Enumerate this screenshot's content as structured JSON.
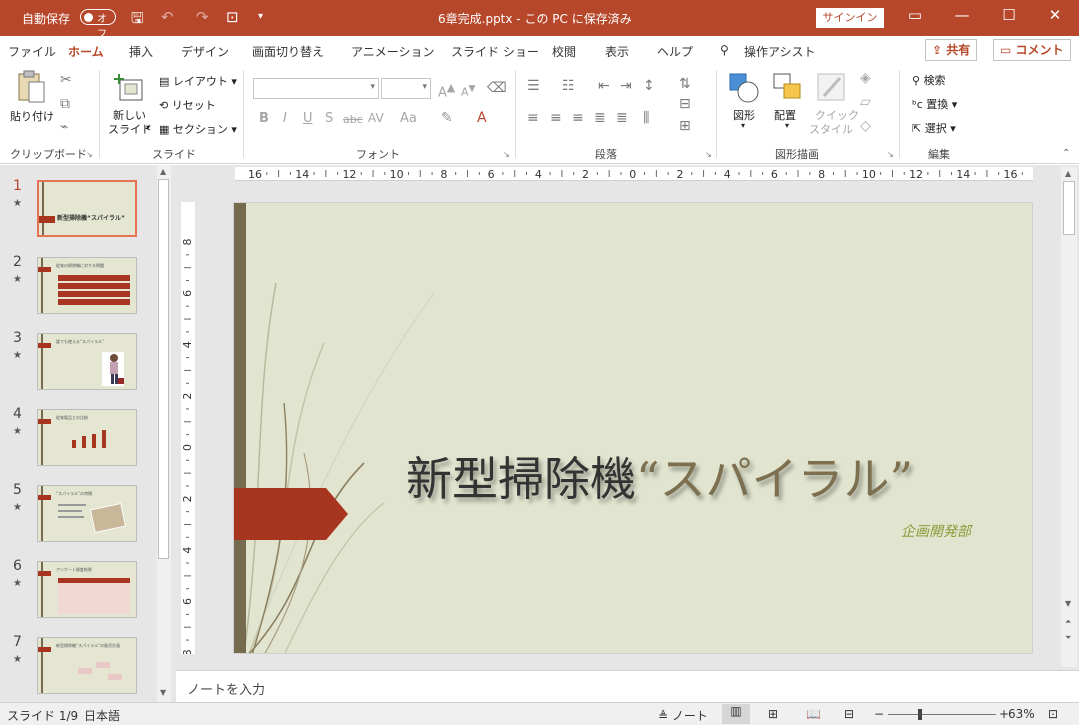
{
  "titlebar": {
    "autosave_label": "自動保存",
    "autosave_state": "オフ",
    "document_title": "6章完成.pptx  -  この PC に保存済み",
    "signin_label": "サインイン"
  },
  "tabs": [
    "ファイル",
    "ホーム",
    "挿入",
    "デザイン",
    "画面切り替え",
    "アニメーション",
    "スライド ショー",
    "校閲",
    "表示",
    "ヘルプ"
  ],
  "active_tab": "ホーム",
  "tell_me": "操作アシスト",
  "share_label": "共有",
  "comment_label": "コメント",
  "ribbon": {
    "clipboard": {
      "paste": "貼り付け",
      "group": "クリップボード"
    },
    "slides": {
      "new_slide_line1": "新しい",
      "new_slide_line2": "スライド",
      "layout": "レイアウト",
      "reset": "リセット",
      "section": "セクション",
      "group": "スライド"
    },
    "font": {
      "group": "フォント",
      "bold": "B",
      "italic": "I",
      "underline": "U",
      "shadow": "S",
      "strike": "abc",
      "spacing": "AV",
      "case": "Aa",
      "grow": "A",
      "shrink": "A"
    },
    "paragraph": {
      "group": "段落"
    },
    "drawing": {
      "shapes": "図形",
      "arrange": "配置",
      "quick_style_line1": "クイック",
      "quick_style_line2": "スタイル",
      "group": "図形描画"
    },
    "editing": {
      "find": "検索",
      "replace": "置換",
      "select": "選択",
      "group": "編集"
    }
  },
  "slides": [
    {
      "number": "1",
      "title": "新型掃除機“スパイラル”"
    },
    {
      "number": "2",
      "title": "従来の掃除機に対する問題"
    },
    {
      "number": "3",
      "title": "誰でも使える“スパイラル”"
    },
    {
      "number": "4",
      "title": "従来製品との比較"
    },
    {
      "number": "5",
      "title": "“スパイラル”の特徴"
    },
    {
      "number": "6",
      "title": "アンケート調査結果"
    },
    {
      "number": "7",
      "title": "新型掃除機“スパイラル”の販売計画"
    }
  ],
  "selected_slide": "1",
  "ruler": {
    "h_labels": [
      "16",
      "14",
      "12",
      "10",
      "8",
      "6",
      "4",
      "2",
      "0",
      "2",
      "4",
      "6",
      "8",
      "10",
      "12",
      "14",
      "16"
    ],
    "v_labels": [
      "8",
      "6",
      "4",
      "2",
      "0",
      "2",
      "4",
      "6",
      "8"
    ]
  },
  "current_slide": {
    "title_main": "新型掃除機",
    "title_accent": "“スパイラル”",
    "subtitle": "企画開発部"
  },
  "notes_placeholder": "ノートを入力",
  "statusbar": {
    "slide_position": "スライド 1/9",
    "language": "日本語",
    "notes_button": "ノート",
    "zoom_level": "63%"
  },
  "colors": {
    "accent": "#b7472a",
    "slide_bg": "#e1e5cf",
    "slide_bar": "#766a4f",
    "subtitle": "#8b9b3a"
  }
}
